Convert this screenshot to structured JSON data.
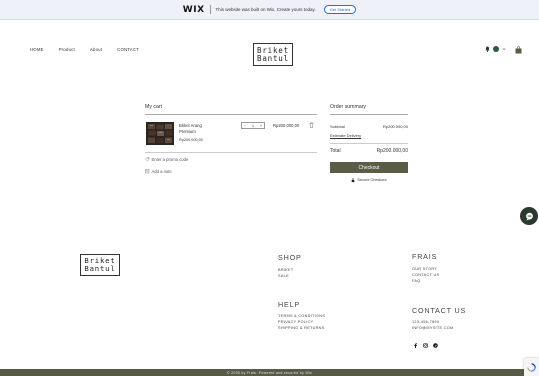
{
  "wix_banner": {
    "logo": "WIX",
    "message": "This website was built on Wix. Create yours today.",
    "cta": "Get Started",
    "accent": "#116dff"
  },
  "header": {
    "nav": [
      "HOME",
      "Product",
      "About",
      "CONTACT"
    ],
    "logo_line1": "Briket",
    "logo_line2": "Bantul",
    "icons": [
      "bell-icon",
      "avatar",
      "chevron-down-icon",
      "shopping-bag-icon"
    ]
  },
  "cart": {
    "title": "My cart",
    "item": {
      "name": "Briket Arang Premium",
      "unit_price": "Rp200.000,00",
      "quantity": "1",
      "minus": "−",
      "plus": "+",
      "total": "Rp200.000,00"
    },
    "promo_link": "Enter a promo code",
    "note_link": "Add a note"
  },
  "summary": {
    "title": "Order summary",
    "subtotal_label": "Subtotal",
    "subtotal_value": "Rp200.000,00",
    "estimate_link": "Estimate Delivery",
    "total_label": "Total",
    "total_value": "Rp200.000,00",
    "checkout_label": "Checkout",
    "secure_label": "Secure Checkout",
    "button_color": "#5b5c45"
  },
  "footer": {
    "logo_line1": "Briket",
    "logo_line2": "Bantul",
    "shop": {
      "heading": "SHOP",
      "items": [
        "BRIKET",
        "SALE"
      ]
    },
    "help": {
      "heading": "HELP",
      "items": [
        "TERMS & CONDITIONS",
        "PRIVACY POLICY",
        "SHIPPING & RETURNS"
      ]
    },
    "frais": {
      "heading": "FRAIS",
      "items": [
        "OUR STORY",
        "CONTACT US",
        "FAQ"
      ]
    },
    "contact": {
      "heading": "CONTACT US",
      "items": [
        "123-456-7890",
        "INFO@MYSITE.COM"
      ]
    },
    "socials": [
      "facebook-icon",
      "instagram-icon",
      "pinterest-icon"
    ],
    "copyright": "© 2035 by Frais. Powered and secured by Wix",
    "bar_color": "#565a46"
  }
}
